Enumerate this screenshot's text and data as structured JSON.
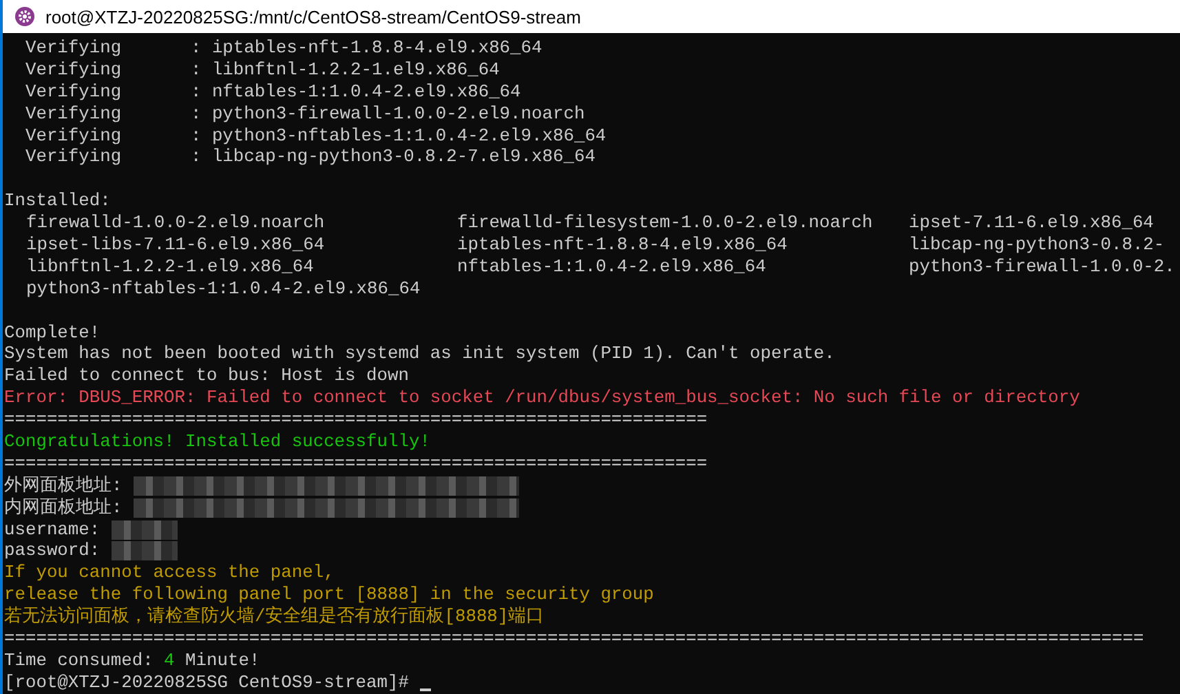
{
  "window": {
    "title": "root@XTZJ-20220825SG:/mnt/c/CentOS8-stream/CentOS9-stream"
  },
  "lines": [
    {
      "kind": "columns",
      "cells": [
        "  Verifying",
        "  : iptables-nft-1.8.8-4.el9.x86_64"
      ]
    },
    {
      "kind": "columns",
      "cells": [
        "  Verifying",
        "  : libnftnl-1.2.2-1.el9.x86_64"
      ]
    },
    {
      "kind": "columns",
      "cells": [
        "  Verifying",
        "  : nftables-1:1.0.4-2.el9.x86_64"
      ]
    },
    {
      "kind": "columns",
      "cells": [
        "  Verifying",
        "  : python3-firewall-1.0.0-2.el9.noarch"
      ]
    },
    {
      "kind": "columns",
      "cells": [
        "  Verifying",
        "  : python3-nftables-1:1.0.4-2.el9.x86_64"
      ]
    },
    {
      "kind": "columns",
      "cells": [
        "  Verifying",
        "  : libcap-ng-python3-0.8.2-7.el9.x86_64"
      ]
    },
    {
      "kind": "blank"
    },
    {
      "kind": "text",
      "text": "Installed:",
      "color": "#cccccc"
    },
    {
      "kind": "packages",
      "cells": [
        "firewalld-1.0.0-2.el9.noarch",
        "firewalld-filesystem-1.0.0-2.el9.noarch",
        "ipset-7.11-6.el9.x86_64"
      ]
    },
    {
      "kind": "packages",
      "cells": [
        "ipset-libs-7.11-6.el9.x86_64",
        "iptables-nft-1.8.8-4.el9.x86_64",
        "libcap-ng-python3-0.8.2-"
      ]
    },
    {
      "kind": "packages",
      "cells": [
        "libnftnl-1.2.2-1.el9.x86_64",
        "nftables-1:1.0.4-2.el9.x86_64",
        "python3-firewall-1.0.0-2."
      ]
    },
    {
      "kind": "packages",
      "cells": [
        "python3-nftables-1:1.0.4-2.el9.x86_64"
      ]
    },
    {
      "kind": "blank"
    },
    {
      "kind": "text",
      "text": "Complete!",
      "color": "#cccccc"
    },
    {
      "kind": "text",
      "text": "System has not been booted with systemd as init system (PID 1). Can't operate.",
      "color": "#cccccc"
    },
    {
      "kind": "text",
      "text": "Failed to connect to bus: Host is down",
      "color": "#cccccc"
    },
    {
      "kind": "text",
      "text": "Error: DBUS_ERROR: Failed to connect to socket /run/dbus/system_bus_socket: No such file or directory",
      "color": "#e74856"
    },
    {
      "kind": "text",
      "text": "==================================================================",
      "color": "#cccccc"
    },
    {
      "kind": "text",
      "text": "Congratulations! Installed successfully!",
      "color": "#16c60c"
    },
    {
      "kind": "text",
      "text": "==================================================================",
      "color": "#cccccc"
    },
    {
      "kind": "address",
      "label": "外网面板地址:"
    },
    {
      "kind": "address",
      "label": "内网面板地址:"
    },
    {
      "kind": "credential",
      "label": "username:"
    },
    {
      "kind": "credential",
      "label": "password:"
    },
    {
      "kind": "text",
      "text": "If you cannot access the panel,",
      "color": "#c19c00"
    },
    {
      "kind": "text",
      "text": "release the following panel port [8888] in the security group",
      "color": "#c19c00"
    },
    {
      "kind": "text",
      "text": "若无法访问面板，请检查防火墙/安全组是否有放行面板[8888]端口",
      "color": "#c19c00"
    },
    {
      "kind": "text",
      "text": "===========================================================================================================",
      "color": "#cccccc"
    },
    {
      "kind": "segments",
      "parts": [
        {
          "text": "Time consumed: ",
          "color": "#cccccc"
        },
        {
          "text": "4",
          "color": "#16c60c"
        },
        {
          "text": " Minute!",
          "color": "#cccccc"
        }
      ]
    },
    {
      "kind": "prompt",
      "text": "[root@XTZJ-20220825SG CentOS9-stream]# "
    }
  ]
}
